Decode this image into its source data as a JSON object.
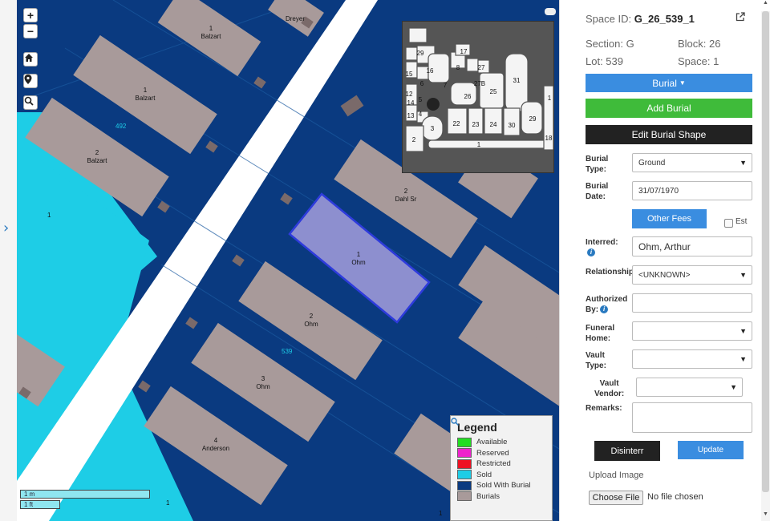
{
  "map": {
    "zoom_in": "+",
    "zoom_out": "−",
    "lot_numbers": [
      "492",
      "539"
    ],
    "section_label": "1",
    "plots": [
      {
        "num": "1",
        "name": "Balzart"
      },
      {
        "num": "1",
        "name": "Balzart"
      },
      {
        "num": "2",
        "name": "Balzart"
      },
      {
        "num": "",
        "name": "Dreyer"
      },
      {
        "num": "2",
        "name": "Dahl Sr"
      },
      {
        "num": "1",
        "name": "Ohm"
      },
      {
        "num": "2",
        "name": "Ohm"
      },
      {
        "num": "3",
        "name": "Ohm"
      },
      {
        "num": "4",
        "name": "Anderson"
      }
    ],
    "bottom_labels": [
      "1",
      "1"
    ],
    "scale": {
      "metric": "1 m",
      "imperial": "1 ft"
    },
    "inset_labels": [
      "29",
      "17",
      "16",
      "8",
      "27",
      "15",
      "7",
      "6",
      "5",
      "26",
      "25",
      "31",
      "14",
      "13",
      "4",
      "3",
      "22",
      "23",
      "24",
      "30",
      "29",
      "2",
      "1",
      "18",
      "27B",
      "12",
      "1"
    ],
    "colors": {
      "map_bg": "#0a3a80",
      "sold": "#1ecde6",
      "plot": "#a89a9a",
      "selected": "#8d8fcf",
      "selected_border": "#2e3bdc"
    }
  },
  "legend": {
    "title": "Legend",
    "items": [
      {
        "label": "Available",
        "color": "#22dd22"
      },
      {
        "label": "Reserved",
        "color": "#ee22cc"
      },
      {
        "label": "Restricted",
        "color": "#ee1122"
      },
      {
        "label": "Sold",
        "color": "#1ecde6"
      },
      {
        "label": "Sold With Burial",
        "color": "#0a3a80"
      },
      {
        "label": "Burials",
        "color": "#a89a9a"
      }
    ]
  },
  "panel": {
    "space_id_label": "Space ID:",
    "space_id": "G_26_539_1",
    "section": "Section: G",
    "block": "Block: 26",
    "lot": "Lot: 539",
    "space": "Space: 1",
    "burial_dropdown": "Burial",
    "add_burial": "Add Burial",
    "edit_shape": "Edit Burial Shape",
    "burial_type_label": [
      "Burial",
      "Type:"
    ],
    "burial_type": "Ground",
    "burial_date_label": [
      "Burial",
      "Date:"
    ],
    "burial_date": "31/07/1970",
    "other_fees": "Other Fees",
    "est_label": "Est",
    "interred_label": "Interred:",
    "interred": "Ohm, Arthur",
    "relationship_label": "Relationship:",
    "relationship": "<UNKNOWN>",
    "authorized_label": [
      "Authorized",
      "By:"
    ],
    "funeral_label": [
      "Funeral",
      "Home:"
    ],
    "vault_type_label": [
      "Vault",
      "Type:"
    ],
    "vault_vendor_label": [
      "Vault",
      "Vendor:"
    ],
    "remarks_label": "Remarks:",
    "disinterr": "Disinterr",
    "update": "Update",
    "upload_image": "Upload Image",
    "choose_file": "Choose File",
    "no_file": "No file chosen"
  }
}
